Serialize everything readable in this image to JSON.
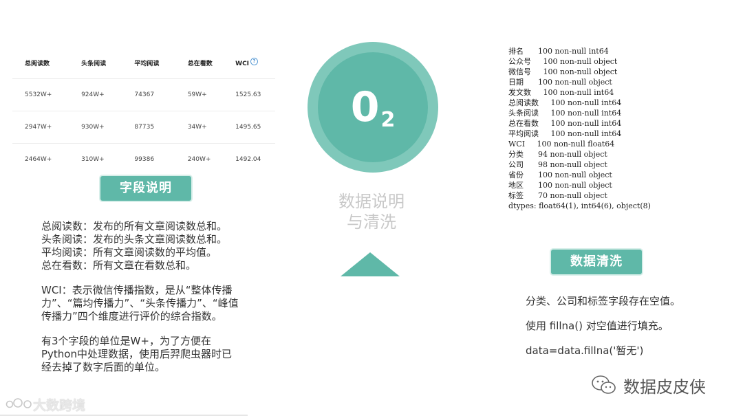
{
  "table": {
    "headers": [
      "总阅读数",
      "头条阅读",
      "平均阅读",
      "总在看数",
      "WCI"
    ],
    "help_symbol": "?",
    "rows": [
      [
        "5532W+",
        "924W+",
        "74367",
        "59W+",
        "1525.63"
      ],
      [
        "2947W+",
        "930W+",
        "87735",
        "34W+",
        "1495.65"
      ],
      [
        "2464W+",
        "310W+",
        "99386",
        "240W+",
        "1492.04"
      ]
    ]
  },
  "left_badge": "字段说明",
  "left_paragraphs": {
    "p1": [
      "总阅读数：发布的所有文章阅读数总和。",
      "头条阅读：发布的头条文章阅读数总和。",
      "平均阅读：所有文章阅读数的平均值。",
      "总在看数：所有文章在看数总和。"
    ],
    "p2": [
      "WCI：表示微信传播指数，是从“整体传播",
      "力”、“篇均传播力”、“头条传播力”、“峰值",
      "传播力”四个维度进行评价的综合指数。"
    ],
    "p3": [
      "有3个字段的单位是W+，为了方便在",
      "Python中处理数据，使用后羿爬虫器时已",
      "经去掉了数字后面的单位。"
    ]
  },
  "section_number": {
    "main": "0",
    "sub": "2"
  },
  "center_title": [
    "数据说明",
    "与清洗"
  ],
  "dtypes": [
    "排名      100 non-null int64",
    "公众号     100 non-null object",
    "微信号     100 non-null object",
    "日期      100 non-null object",
    "发文数     100 non-null int64",
    "总阅读数     100 non-null int64",
    "头条阅读     100 non-null int64",
    "总在看数     100 non-null int64",
    "平均阅读     100 non-null int64",
    "WCI     100 non-null float64",
    "分类      94 non-null object",
    "公司      98 non-null object",
    "省份      100 non-null object",
    "地区      100 non-null object",
    "标签      70 non-null object",
    "dtypes: float64(1), int64(6), object(8)"
  ],
  "right_badge": "数据清洗",
  "right_paragraphs": [
    "分类、公司和标签字段存在空值。",
    "使用  fillna() 对空值进行填充。",
    "data=data.fillna('暂无')"
  ],
  "watermark": "数据皮皮侠",
  "logo": "大数跨境",
  "colors": {
    "accent": "#5fb8a8",
    "accent_light": "#7fc8ba"
  },
  "icons": [
    "wechat-icon",
    "logo-icon"
  ]
}
